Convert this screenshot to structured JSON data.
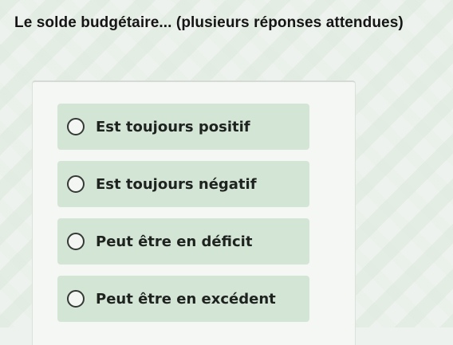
{
  "question": {
    "title": "Le solde budgétaire... (plusieurs réponses attendues)"
  },
  "options": [
    {
      "label": "Est toujours positif",
      "selected": false
    },
    {
      "label": "Est toujours négatif",
      "selected": false
    },
    {
      "label": "Peut être en déficit",
      "selected": false
    },
    {
      "label": "Peut être en excédent",
      "selected": false
    }
  ],
  "colors": {
    "background": "#eef2ee",
    "option_background": "#d3e5d4",
    "text": "#1f2320"
  }
}
